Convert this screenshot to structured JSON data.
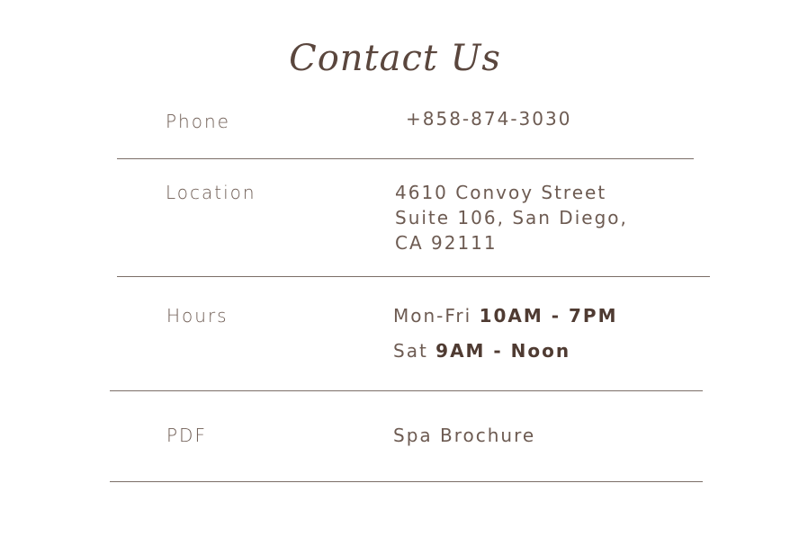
{
  "title": "Contact Us",
  "rows": {
    "phone": {
      "label": "Phone",
      "value": "+858-874-3030"
    },
    "location": {
      "label": "Location",
      "lines": [
        "4610 Convoy Street",
        "Suite 106, San Diego,",
        "CA 92111"
      ]
    },
    "hours": {
      "label": "Hours",
      "weekday_prefix": "Mon-Fri",
      "weekday_time": "10AM - 7PM",
      "saturday_prefix": "Sat",
      "saturday_time": "9AM - Noon"
    },
    "pdf": {
      "label": "PDF",
      "value": "Spa Brochure"
    }
  },
  "colors": {
    "text": "#6d5b52",
    "heading": "#5a463d",
    "divider": "#7b6e67",
    "background": "#ffffff"
  }
}
